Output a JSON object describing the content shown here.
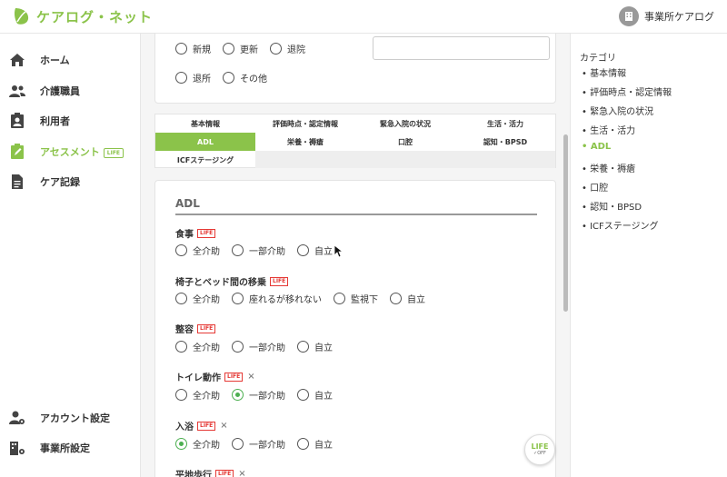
{
  "header": {
    "brand": "ケアログ・ネット",
    "office_label": "事業所ケアログ",
    "brand_color": "#8bc34a"
  },
  "sidebar": {
    "items": [
      {
        "label": "ホーム",
        "icon": "home-icon"
      },
      {
        "label": "介護職員",
        "icon": "staff-icon"
      },
      {
        "label": "利用者",
        "icon": "user-icon"
      },
      {
        "label": "アセスメント",
        "icon": "assessment-icon",
        "tag": "LIFE",
        "active": true
      },
      {
        "label": "ケア記録",
        "icon": "document-icon"
      }
    ],
    "bottom_items": [
      {
        "label": "アカウント設定",
        "icon": "account-settings-icon"
      },
      {
        "label": "事業所設定",
        "icon": "office-settings-icon"
      }
    ]
  },
  "top_radios": {
    "row1": [
      "新規",
      "更新",
      "退院"
    ],
    "row2": [
      "退所",
      "その他"
    ]
  },
  "tabs": {
    "row1": [
      "基本情報",
      "評価時点・認定情報",
      "緊急入院の状況",
      "生活・活力"
    ],
    "row2": [
      "ADL",
      "栄養・褥瘡",
      "口腔",
      "認知・BPSD"
    ],
    "row3": [
      "ICFステージング"
    ],
    "active": "ADL"
  },
  "adl": {
    "title": "ADL",
    "life_tag": "LIFE",
    "clear_icon": "×",
    "questions": [
      {
        "label": "食事",
        "options": [
          "全介助",
          "一部介助",
          "自立"
        ],
        "selected": null,
        "clear": false
      },
      {
        "label": "椅子とベッド間の移乗",
        "options": [
          "全介助",
          "座れるが移れない",
          "監視下",
          "自立"
        ],
        "selected": null,
        "clear": false
      },
      {
        "label": "整容",
        "options": [
          "全介助",
          "一部介助",
          "自立"
        ],
        "selected": null,
        "clear": false
      },
      {
        "label": "トイレ動作",
        "options": [
          "全介助",
          "一部介助",
          "自立"
        ],
        "selected": "一部介助",
        "clear": true
      },
      {
        "label": "入浴",
        "options": [
          "全介助",
          "一部介助",
          "自立"
        ],
        "selected": "全介助",
        "clear": true
      },
      {
        "label": "平地歩行",
        "options": [],
        "selected": null,
        "clear": true
      }
    ]
  },
  "life_fab": {
    "label": "LIFE",
    "sub": "✓OFF"
  },
  "categories": {
    "title": "カテゴリ",
    "items": [
      "基本情報",
      "評価時点・認定情報",
      "緊急入院の状況",
      "生活・活力",
      "ADL",
      "栄養・褥瘡",
      "口腔",
      "認知・BPSD",
      "ICFステージング"
    ],
    "active": "ADL"
  }
}
